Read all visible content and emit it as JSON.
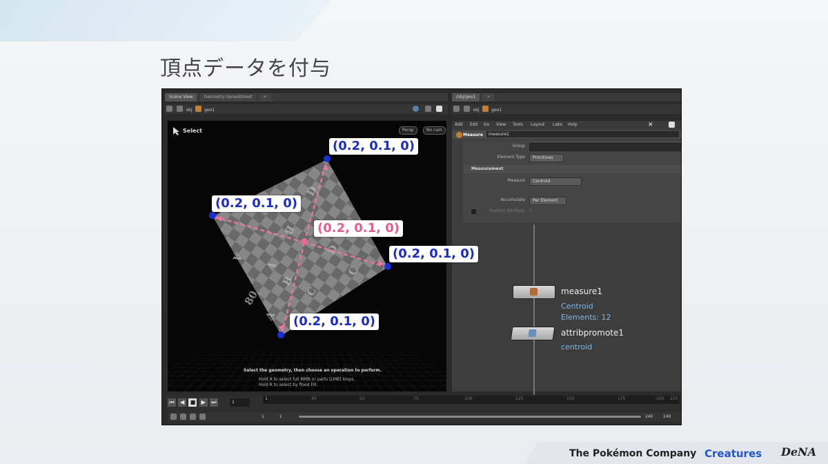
{
  "slide": {
    "title": "頂点データを付与"
  },
  "app": {
    "left_tabs": [
      "Scene View",
      "Geometry Spreadsheet"
    ],
    "right_tabs": [
      "/obj/geo1"
    ],
    "left_path": [
      "obj",
      "geo1"
    ],
    "right_path": [
      "obj",
      "geo1"
    ],
    "menu": [
      "Add",
      "Edit",
      "Go",
      "View",
      "Tools",
      "Layout",
      "Labs",
      "Help"
    ]
  },
  "viewport": {
    "mode_label": "Select",
    "btn_persp": "Persp",
    "btn_nocam": "No cam",
    "help_title": "Select the geometry, then choose an operation to perform.",
    "help_line1": "Hold A to select full MMB or parts [LMB] loops.",
    "help_line2": "Hold R to select by flood Fill."
  },
  "params": {
    "node_type": "Measure",
    "node_name": "measure1",
    "group_label": "Group",
    "group_value": "",
    "element_type_label": "Element Type",
    "element_type_value": "Primitives",
    "section_measurement": "Measurement",
    "measure_label": "Measure",
    "measure_value": "Centroid",
    "accumulate_label": "Accumulate",
    "accumulate_value": "Per Element",
    "position_attr_label": "Position Attribute",
    "position_attr_value": "P"
  },
  "network": {
    "nodes": [
      {
        "name": "measure1",
        "sub": [
          "Centroid",
          "Elements: 12"
        ]
      },
      {
        "name": "attribpromote1",
        "sub": [
          "centroid"
        ]
      }
    ]
  },
  "timeline": {
    "current_frame": "1",
    "ticks": [
      "1",
      "30",
      "50",
      "75",
      "100",
      "125",
      "150",
      "175",
      "200",
      "225"
    ],
    "start": "1",
    "start2": "1",
    "end": "240",
    "end2": "240"
  },
  "annotations": {
    "top": "(0.2, 0.1, 0)",
    "left": "(0.2, 0.1, 0)",
    "center": "(0.2, 0.1, 0)",
    "right": "(0.2, 0.1, 0)",
    "bottom": "(0.2, 0.1, 0)"
  },
  "colors": {
    "vertex_dot": "#1530d8",
    "centroid": "#e56a97",
    "label_blue": "#1a2cc4",
    "label_pink": "#e0608a"
  },
  "footer": {
    "logo1": "The Pokémon Company",
    "logo2": "Creatures",
    "logo3": "DeNA"
  }
}
